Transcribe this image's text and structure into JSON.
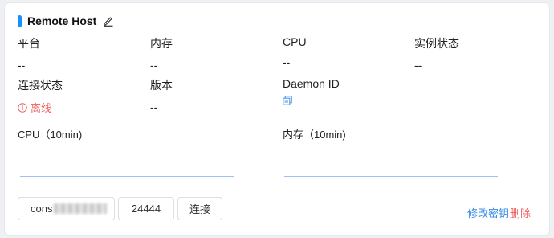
{
  "card": {
    "title": "Remote Host",
    "accent_color": "#1890ff",
    "edit_icon": "pencil-edit-icon"
  },
  "info": {
    "platform": {
      "label": "平台",
      "value": "--"
    },
    "memory": {
      "label": "内存",
      "value": "--"
    },
    "cpu": {
      "label": "CPU",
      "value": "--"
    },
    "instance_status": {
      "label": "实例状态",
      "value": "--"
    },
    "connection_status": {
      "label": "连接状态",
      "value": "离线",
      "icon": "info-circle-icon",
      "color": "#ee5d5d"
    },
    "version": {
      "label": "版本",
      "value": "--"
    },
    "daemon_id": {
      "label": "Daemon ID",
      "icon": "copy-icon"
    }
  },
  "charts": {
    "cpu_title": "CPU（10min)",
    "memory_title": "内存（10min)",
    "line_color": "#9fc1ef"
  },
  "controls": {
    "address_visible_prefix": "cons",
    "port_value": "24444",
    "connect_label": "连接",
    "change_key_label": "修改密钥",
    "delete_label": "删除",
    "link_color": "#3b8ee5",
    "danger_color": "#ee5d5d"
  }
}
